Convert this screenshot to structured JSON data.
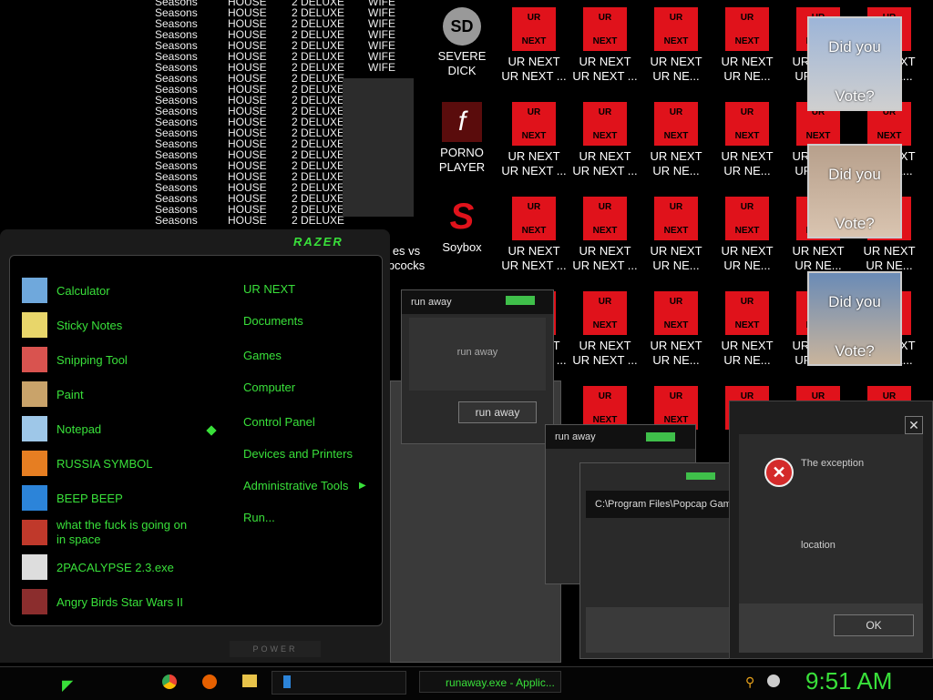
{
  "list": {
    "col1": "Seasons",
    "col2": "HOUSE",
    "col3": "2 DELUXE",
    "col4": "WIFE"
  },
  "desktop": {
    "icons": [
      {
        "label": "SEVERE DICK"
      },
      {
        "label": "PORNO PLAYER"
      },
      {
        "label": "Soybox"
      },
      {
        "label": "es vs pcocks"
      },
      {
        "label": "UR NEXT"
      },
      {
        "label": "UR NEXT ..."
      },
      {
        "label": "UR NE..."
      }
    ],
    "ur_top": "UR",
    "ur_bottom": "NEXT"
  },
  "photos": [
    {
      "line1": "Did you",
      "line2": "Vote?"
    },
    {
      "line1": "Did you",
      "line2": "Vote?"
    },
    {
      "line1": "Did you",
      "line2": "Vote?"
    }
  ],
  "start_menu": {
    "brand": "RAZER",
    "left_items": [
      {
        "label": "Calculator"
      },
      {
        "label": "Sticky Notes"
      },
      {
        "label": "Snipping Tool"
      },
      {
        "label": "Paint"
      },
      {
        "label": "Notepad"
      },
      {
        "label": "RUSSIA SYMBOL"
      },
      {
        "label": "BEEP BEEP"
      },
      {
        "label": "what the fuck is going on in space"
      },
      {
        "label": "2PACALYPSE 2.3.exe"
      },
      {
        "label": "Angry Birds Star Wars II"
      }
    ],
    "right_items": [
      {
        "label": "UR NEXT"
      },
      {
        "label": "Documents"
      },
      {
        "label": "Games"
      },
      {
        "label": "Computer"
      },
      {
        "label": "Control Panel"
      },
      {
        "label": "Devices and Printers"
      },
      {
        "label": "Administrative Tools"
      },
      {
        "label": "Run..."
      }
    ],
    "power": "POWER"
  },
  "dialogs": {
    "runaway_title": "run away",
    "runaway_text": "run away",
    "runaway_button": "run away",
    "path_title": "C:\\Program Files\\Popcap Game",
    "error_text": "The exception",
    "error_location": "location",
    "ok_button": "OK"
  },
  "taskbar": {
    "active_task": "runaway.exe - Applic...",
    "clock": "9:51 AM"
  }
}
